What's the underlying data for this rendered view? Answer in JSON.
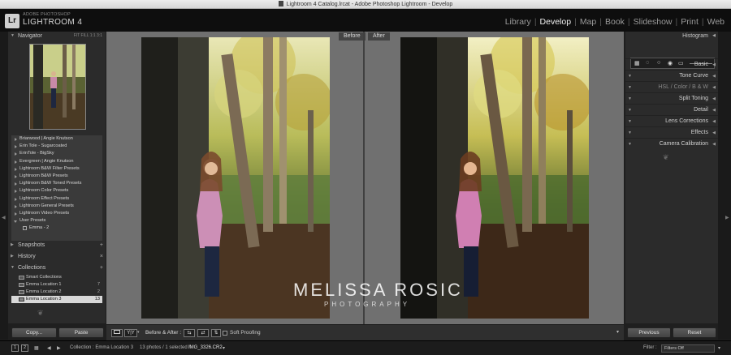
{
  "window": {
    "title": "Lightroom 4 Catalog.lrcat - Adobe Photoshop Lightroom - Develop"
  },
  "identity": {
    "badge": "Lr",
    "vendor": "ADOBE PHOTOSHOP",
    "product": "LIGHTROOM 4"
  },
  "modules": [
    "Library",
    "Develop",
    "Map",
    "Book",
    "Slideshow",
    "Print",
    "Web"
  ],
  "active_module": "Develop",
  "left_panel": {
    "navigator": {
      "title": "Navigator",
      "zoom": "FIT   FILL   1:1   3:1"
    },
    "presets": [
      {
        "label": "Briarwood | Angie Knutson",
        "open": false
      },
      {
        "label": "Erin Tole - Sugarcoated",
        "open": false
      },
      {
        "label": "ErinTole - BigSky",
        "open": false
      },
      {
        "label": "Evergreen | Angie Knutson",
        "open": false
      },
      {
        "label": "Lightroom B&W Filter Presets",
        "open": false
      },
      {
        "label": "Lightroom B&W Presets",
        "open": false
      },
      {
        "label": "Lightroom B&W Toned Presets",
        "open": false
      },
      {
        "label": "Lightroom Color Presets",
        "open": false
      },
      {
        "label": "Lightroom Effect Presets",
        "open": false
      },
      {
        "label": "Lightroom General Presets",
        "open": false
      },
      {
        "label": "Lightroom Video Presets",
        "open": false
      },
      {
        "label": "User Presets",
        "open": true
      },
      {
        "label": "Emma - 2",
        "child": true
      }
    ],
    "snapshots": {
      "title": "Snapshots",
      "action": "+"
    },
    "history": {
      "title": "History",
      "action": "×"
    },
    "collections": {
      "title": "Collections",
      "action": "+",
      "items": [
        {
          "label": "Smart Collections",
          "count": ""
        },
        {
          "label": "Emma Location 1",
          "count": "7"
        },
        {
          "label": "Emma Location 2",
          "count": "2"
        },
        {
          "label": "Emma Location 3",
          "count": "13",
          "selected": true
        }
      ]
    },
    "copy_label": "Copy...",
    "paste_label": "Paste"
  },
  "right_panel": {
    "histogram_title": "Histogram",
    "sections": [
      "Basic",
      "Tone Curve",
      "HSL  /  Color  /  B & W",
      "Split Toning",
      "Detail",
      "Lens Corrections",
      "Effects",
      "Camera Calibration"
    ]
  },
  "center": {
    "before_label": "Before",
    "after_label": "After",
    "watermark_name": "MELISSA ROSIC",
    "watermark_sub": "PHOTOGRAPHY"
  },
  "toolbar": {
    "view_btn": "",
    "yy_btn": "Y|Y",
    "before_after_label": "Before & After :",
    "soft_proofing_label": "Soft Proofing"
  },
  "bottom_buttons": {
    "previous_label": "Previous",
    "reset_label": "Reset"
  },
  "filmstrip": {
    "page1": "1",
    "page2": "2",
    "source": "Collection : Emma Location 3",
    "info": "13 photos / 1 selected /",
    "file": "IMG_3326.CR2",
    "filter_label": "Filter :",
    "filter_value": "Filters Off"
  }
}
